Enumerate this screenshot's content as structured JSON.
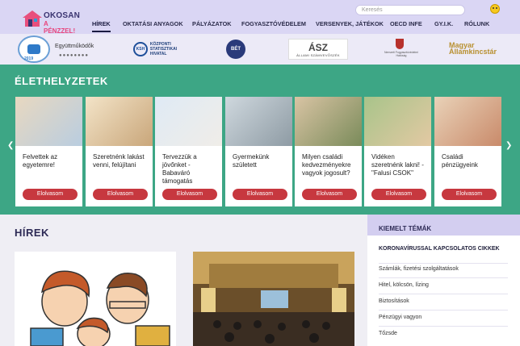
{
  "header": {
    "logo_line1": "OKOSAN",
    "logo_line2": "A PÉNZZEL!",
    "search_placeholder": "Keresés",
    "nav": [
      "HÍREK",
      "OKTATÁSI ANYAGOK",
      "PÁLYÁZATOK",
      "FOGYASZTÓVÉDELEM",
      "VERSENYEK, JÁTÉKOK",
      "OECD INFE",
      "GY.I.K.",
      "RÓLUNK"
    ]
  },
  "partners": {
    "badge_year": "2019",
    "coop_label": "Együttműködők",
    "dots": "●●●●●●●●",
    "ksh_line1": "KÖZPONTI",
    "ksh_line2": "STATISZTIKAI",
    "ksh_line3": "HIVATAL",
    "ksh_abbr": "KSH",
    "bet": "BÉT",
    "asz": "ÁSZ",
    "asz_sub": "ÁLLAMI SZÁMVEVŐSZÉK",
    "crest_text": "Nemzeti Fogyasztóvédelmi Hatóság",
    "ma_line1": "Magyar",
    "ma_line2": "Államkincstár"
  },
  "life": {
    "title": "ÉLETHELYZETEK",
    "cards": [
      {
        "text": "Felvettek az egyetemre!",
        "button": "Elolvasom"
      },
      {
        "text": "Szeretnénk lakást venni, felújítani",
        "button": "Elolvasom"
      },
      {
        "text": "Tervezzük a jövőnket - Babaváró támogatás",
        "button": "Elolvasom"
      },
      {
        "text": "Gyermekünk született",
        "button": "Elolvasom"
      },
      {
        "text": "Milyen családi kedvezményekre vagyok jogosult?",
        "button": "Elolvasom"
      },
      {
        "text": "Vidéken szeretnénk lakni! - \"Falusi CSOK\"",
        "button": "Elolvasom"
      },
      {
        "text": "Családi pénzügyeink",
        "button": "Elolvasom"
      }
    ]
  },
  "news": {
    "title": "HÍREK"
  },
  "sidebar": {
    "title": "KIEMELT TÉMÁK",
    "first": "KORONAVÍRUSSAL KAPCSOLATOS CIKKEK",
    "items": [
      "Számlák, fizetési szolgáltatások",
      "Hitel, kölcsön, lízing",
      "Biztosítások",
      "Pénzügyi vagyon",
      "Tőzsde"
    ]
  },
  "colors": {
    "header": "#dad6f4",
    "green": "#3da685",
    "button": "#c7383f"
  }
}
